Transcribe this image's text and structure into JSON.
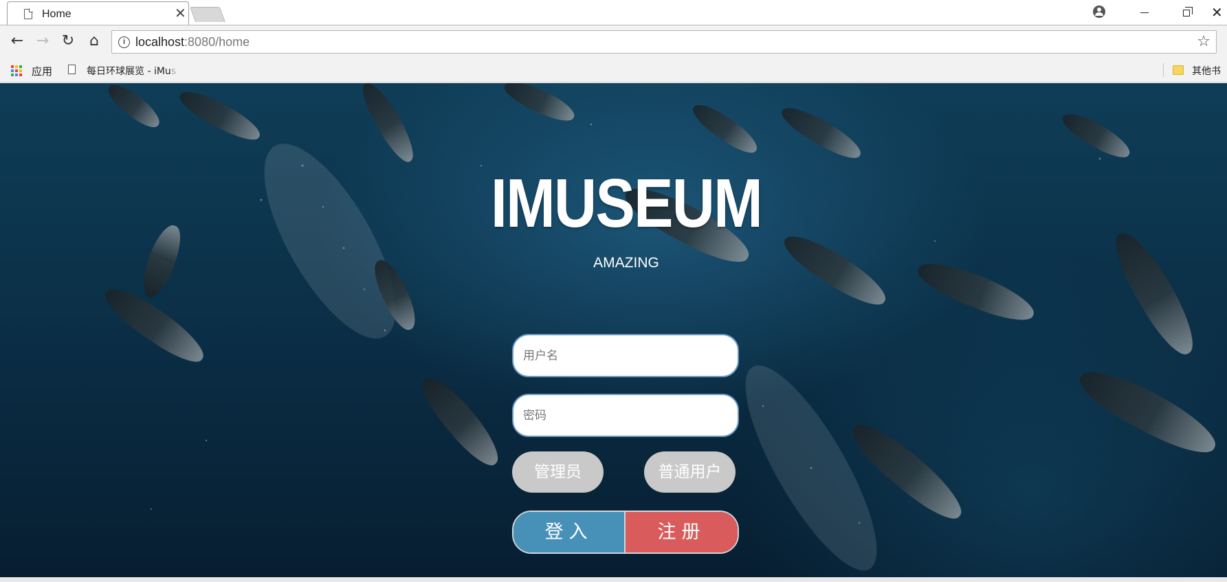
{
  "browser": {
    "tab": {
      "title": "Home",
      "close_glyph": "✕"
    },
    "window_controls": {
      "close_glyph": "✕"
    },
    "address_bar": {
      "host": "localhost",
      "path": ":8080/home"
    },
    "bookmarks": {
      "apps_label": "应用",
      "page_label": "每日环球展览 - iMu",
      "page_label_faded": "s",
      "other_label": "其他书"
    },
    "icons": [
      "page-icon",
      "profile-icon",
      "back-icon",
      "forward-icon",
      "reload-icon",
      "home-icon",
      "info-icon",
      "star-icon",
      "apps-icon",
      "folder-icon"
    ]
  },
  "page": {
    "title": "IMUSEUM",
    "subtitle": "AMAZING",
    "form": {
      "username_placeholder": "用户名",
      "password_placeholder": "密码",
      "role_admin_label": "管理员",
      "role_user_label": "普通用户",
      "login_label": "登入",
      "register_label": "注册"
    },
    "colors": {
      "login": "#4791b8",
      "register": "#d95b5b",
      "role_button": "#c9c9c9",
      "background": "#0b3048"
    }
  }
}
